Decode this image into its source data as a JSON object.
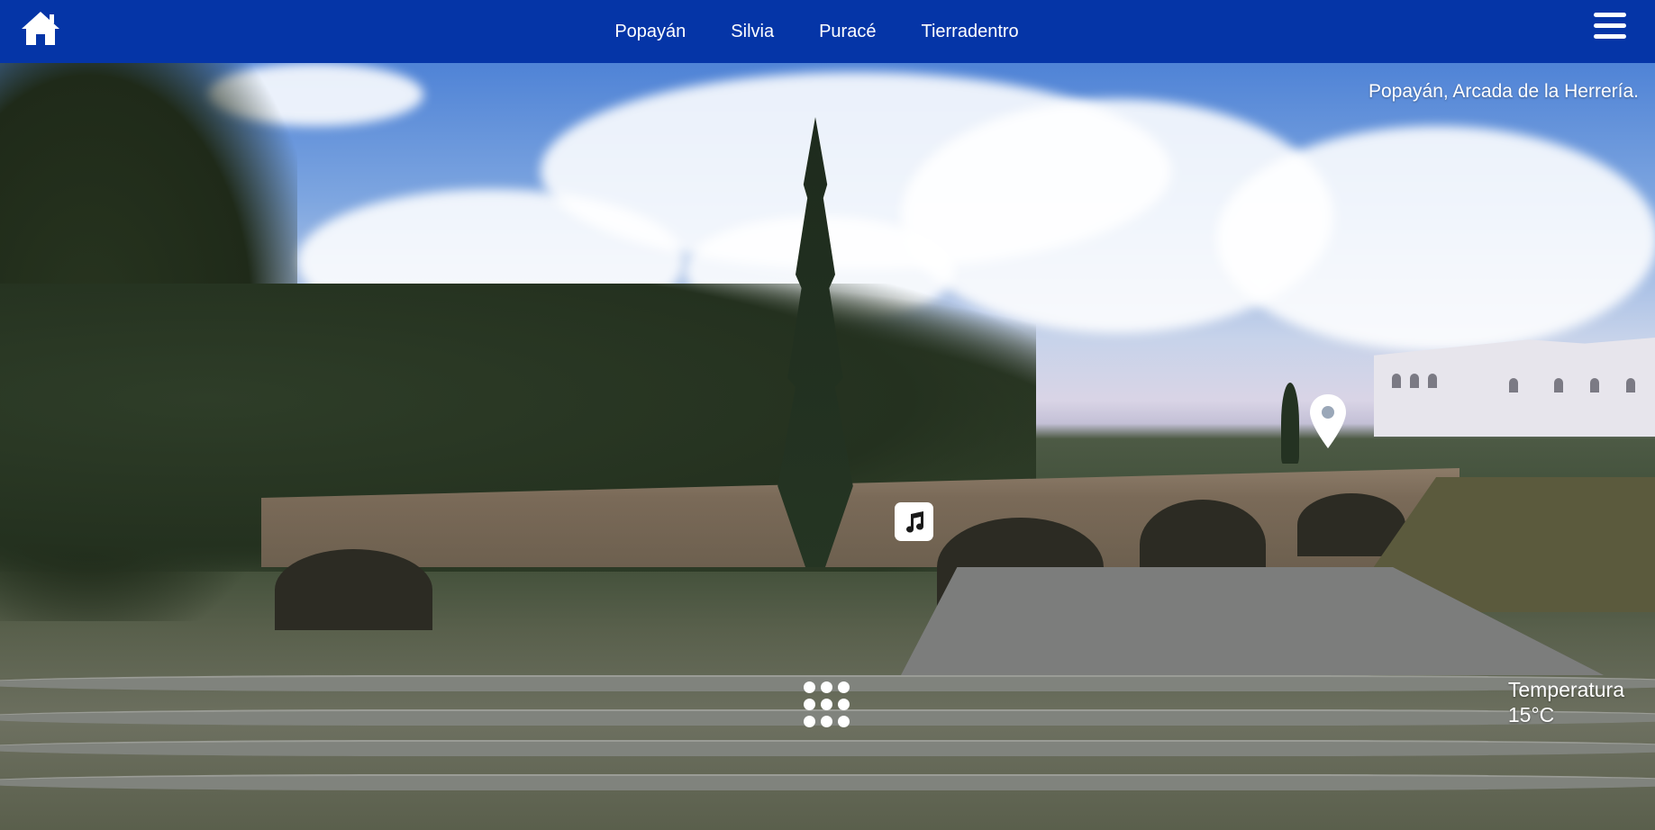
{
  "navbar": {
    "home_icon": "home-icon",
    "links": [
      "Popayán",
      "Silvia",
      "Puracé",
      "Tierradentro"
    ],
    "menu_icon": "hamburger-menu-icon",
    "background": "#0535a7"
  },
  "scene": {
    "caption": "Popayán, Arcada de la Herrería.",
    "hotspots": {
      "location": "map-pin-icon",
      "audio": "music-note-icon"
    },
    "apps_icon": "grid-dots-icon"
  },
  "weather": {
    "label": "Temperatura",
    "value": "15°C"
  }
}
